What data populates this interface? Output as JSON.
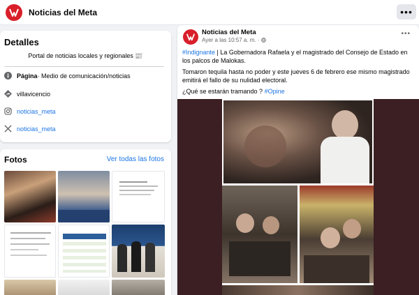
{
  "header": {
    "page_name": "Noticias del Meta",
    "more_label": "•••",
    "brand_color": "#d81f2a"
  },
  "details": {
    "title": "Detalles",
    "intro": "Portal de noticias locales y regionales 📰",
    "category_label": "Página",
    "category_value": " · Medio de comunicación/noticias",
    "location": "villavicencio",
    "instagram": "noticias_meta",
    "x_handle": "noticias_meta",
    "icons": [
      "info-icon",
      "location-pin-icon",
      "instagram-icon",
      "x-icon"
    ]
  },
  "photos": {
    "title": "Fotos",
    "see_all": "Ver todas las fotos"
  },
  "post": {
    "author": "Noticias del Meta",
    "time": "Ayer a las 10:57 a. m. ·",
    "more_label": "•••",
    "hashtag1": "#Indignante",
    "paragraph1": " | La Gobernadora Rafaela y el magistrado del Consejo de Estado en los palcos de Malokas.",
    "paragraph2": "Tomaron tequila hasta no poder y este jueves 6 de febrero ese mismo magistrado emitirá el fallo de su nulidad electoral.",
    "paragraph3": "¿Qué se estarán tramando ? ",
    "hashtag2": "#Opine"
  },
  "colors": {
    "link": "#1b74e4",
    "background": "#f0f2f5",
    "card": "#ffffff"
  }
}
